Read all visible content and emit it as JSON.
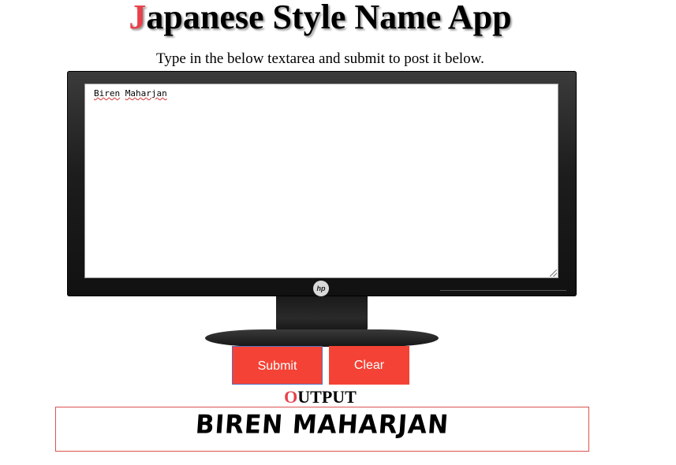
{
  "header": {
    "title_first_letter": "J",
    "title_rest": "apanese Style Name App",
    "subtitle": "Type in the below textarea and submit to post it below."
  },
  "monitor": {
    "textarea_value_first": "Biren",
    "textarea_value_second": "Maharjan",
    "brand": "hp"
  },
  "buttons": {
    "submit_label": "Submit",
    "clear_label": "Clear"
  },
  "output": {
    "label_first_letter": "O",
    "label_rest": "UTPUT",
    "value": "BIREN MAHARJAN"
  },
  "colors": {
    "accent": "#f44336",
    "title_letter": "#e8414a"
  }
}
